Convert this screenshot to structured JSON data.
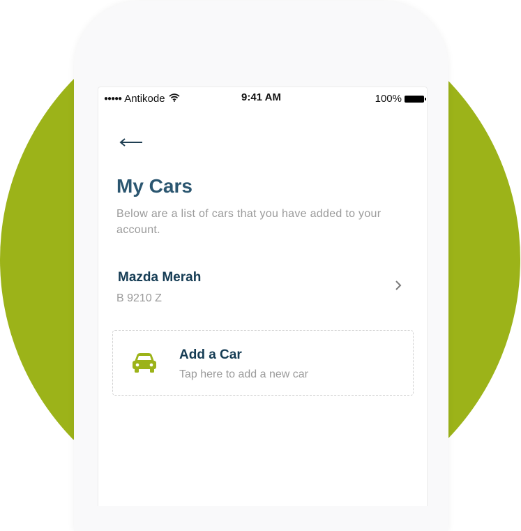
{
  "status_bar": {
    "signal_dots": "●●●●●",
    "carrier": "Antikode",
    "time": "9:41 AM",
    "battery_percent": "100%"
  },
  "nav": {
    "back_icon": "back-arrow-icon"
  },
  "page": {
    "title": "My Cars",
    "subtitle": "Below are a list of cars that you have added to your account."
  },
  "cars": [
    {
      "name": "Mazda Merah",
      "plate": "B 9210 Z"
    }
  ],
  "add_car": {
    "title": "Add a Car",
    "subtitle": "Tap here to add a new car",
    "icon": "car-icon"
  },
  "colors": {
    "accent": "#9cb319",
    "heading": "#2b5670",
    "text_dark": "#153c54",
    "text_muted": "#9a9a9a"
  }
}
